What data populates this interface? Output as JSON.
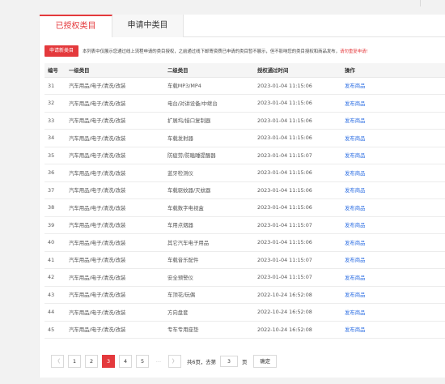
{
  "tabs": [
    {
      "label": "已授权类目"
    },
    {
      "label": "申请中类目"
    }
  ],
  "notice": {
    "button_label": "申请新类目",
    "text_before": "本列表中仅展示您通过线上流程申请的类目授权，之前通过线下邮寄资质已申请的类目暂不展示，但不影响您的类目授权和商品发布，",
    "text_highlight": "请勿重复申请!"
  },
  "table": {
    "headers": [
      "编号",
      "一级类目",
      "二级类目",
      "授权通过时间",
      "操作"
    ],
    "rows": [
      {
        "id": "31",
        "level1": "汽车用品/电子/清洗/改装",
        "level2": "车载MP3/MP4",
        "time": "2023-01-04 11:15:06",
        "action": "发布商品"
      },
      {
        "id": "32",
        "level1": "汽车用品/电子/清洗/改装",
        "level2": "电台/对讲设备/中继台",
        "time": "2023-01-04 11:15:06",
        "action": "发布商品"
      },
      {
        "id": "33",
        "level1": "汽车用品/电子/清洗/改装",
        "level2": "扩展坞/接口复制器",
        "time": "2023-01-04 11:15:06",
        "action": "发布商品"
      },
      {
        "id": "34",
        "level1": "汽车用品/电子/清洗/改装",
        "level2": "车载发射器",
        "time": "2023-01-04 11:15:06",
        "action": "发布商品"
      },
      {
        "id": "35",
        "level1": "汽车用品/电子/清洗/改装",
        "level2": "防疲劳/防瞌睡提醒器",
        "time": "2023-01-04 11:15:07",
        "action": "发布商品"
      },
      {
        "id": "36",
        "level1": "汽车用品/电子/清洗/改装",
        "level2": "蓝牙检测仪",
        "time": "2023-01-04 11:15:06",
        "action": "发布商品"
      },
      {
        "id": "37",
        "level1": "汽车用品/电子/清洗/改装",
        "level2": "车载驱蚊器/灭蚊器",
        "time": "2023-01-04 11:15:06",
        "action": "发布商品"
      },
      {
        "id": "38",
        "level1": "汽车用品/电子/清洗/改装",
        "level2": "车载数字电视盒",
        "time": "2023-01-04 11:15:06",
        "action": "发布商品"
      },
      {
        "id": "39",
        "level1": "汽车用品/电子/清洗/改装",
        "level2": "车用点烟器",
        "time": "2023-01-04 11:15:07",
        "action": "发布商品"
      },
      {
        "id": "40",
        "level1": "汽车用品/电子/清洗/改装",
        "level2": "其它汽车电子用品",
        "time": "2023-01-04 11:15:06",
        "action": "发布商品"
      },
      {
        "id": "41",
        "level1": "汽车用品/电子/清洗/改装",
        "level2": "车载音乐配件",
        "time": "2023-01-04 11:15:07",
        "action": "发布商品"
      },
      {
        "id": "42",
        "level1": "汽车用品/电子/清洗/改装",
        "level2": "安全预警仪",
        "time": "2023-01-04 11:15:07",
        "action": "发布商品"
      },
      {
        "id": "43",
        "level1": "汽车用品/电子/清洗/改装",
        "level2": "车顶花/玩偶",
        "time": "2022-10-24 16:52:08",
        "action": "发布商品"
      },
      {
        "id": "44",
        "level1": "汽车用品/电子/清洗/改装",
        "level2": "方向盘套",
        "time": "2022-10-24 16:52:08",
        "action": "发布商品"
      },
      {
        "id": "45",
        "level1": "汽车用品/电子/清洗/改装",
        "level2": "专车专用座垫",
        "time": "2022-10-24 16:52:08",
        "action": "发布商品"
      }
    ]
  },
  "pagination": {
    "prev_icon": "chevron-left-icon",
    "next_icon": "chevron-right-icon",
    "pages": [
      "1",
      "2",
      "3",
      "4",
      "5"
    ],
    "current_page": "3",
    "dots": "…",
    "total_text": "共6页，去第",
    "goto_value": "3",
    "page_suffix": "页",
    "ok_label": "确定"
  },
  "colors": {
    "accent": "#e4393c",
    "link": "#2b6de3"
  }
}
